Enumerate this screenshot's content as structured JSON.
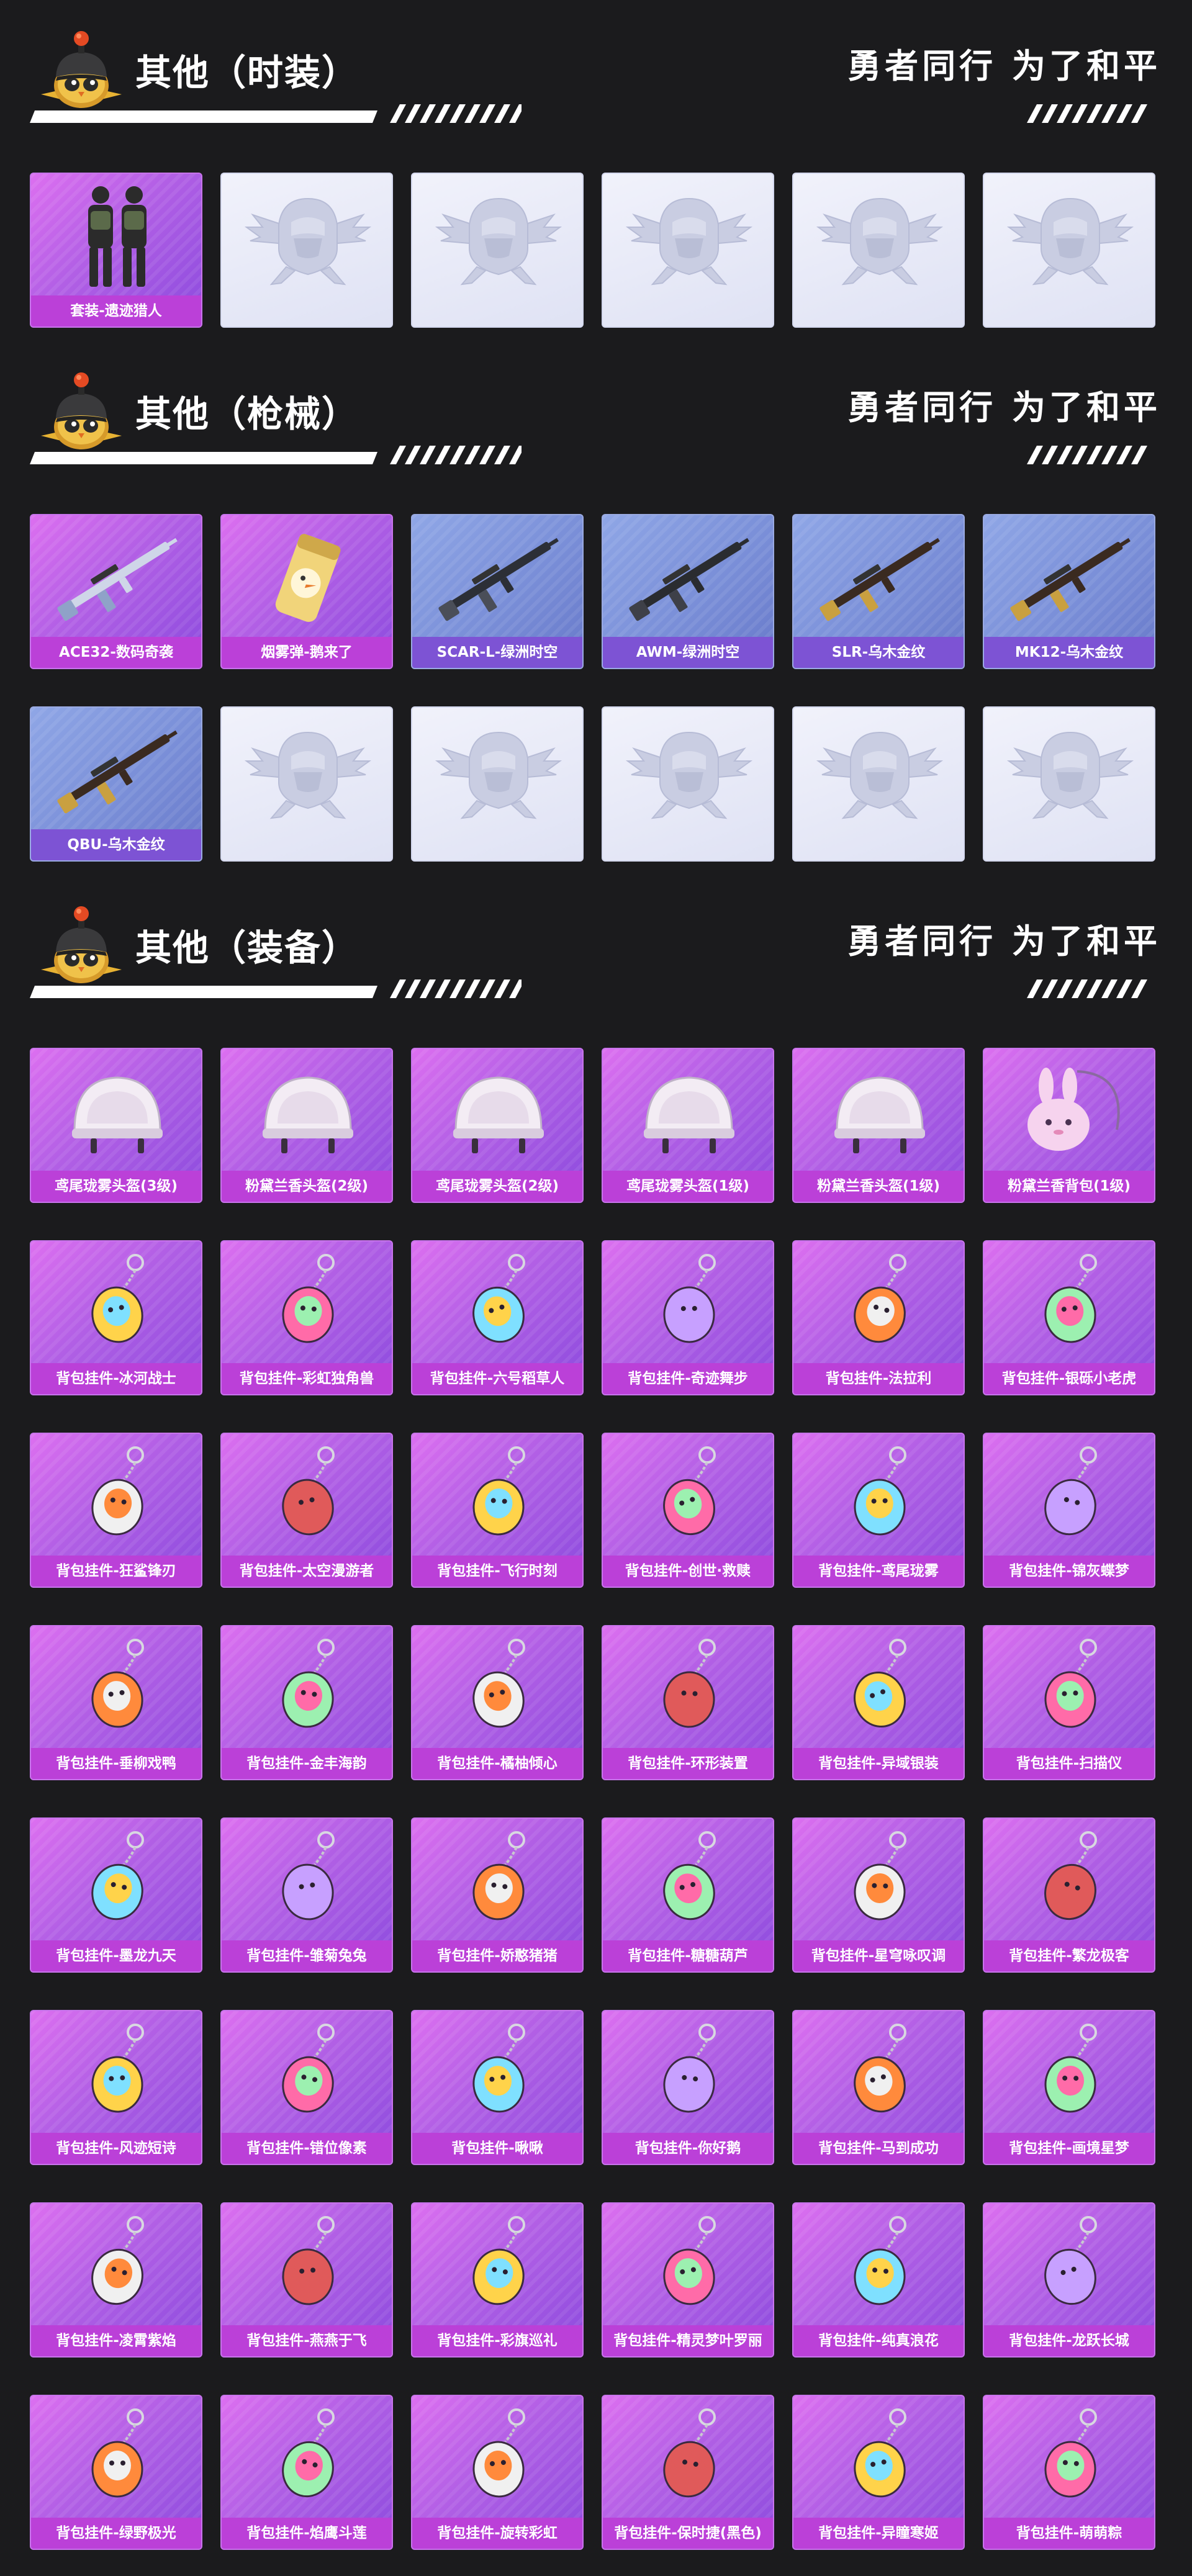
{
  "slogan": "勇者同行 为了和平",
  "sections": [
    {
      "title": "其他（时装）",
      "rows": [
        [
          {
            "label": "套装-遗迹猎人",
            "style": "purple",
            "icon": "outfit-icon"
          },
          {
            "style": "empty",
            "icon": "placeholder-emblem-icon"
          },
          {
            "style": "empty",
            "icon": "placeholder-emblem-icon"
          },
          {
            "style": "empty",
            "icon": "placeholder-emblem-icon"
          },
          {
            "style": "empty",
            "icon": "placeholder-emblem-icon"
          },
          {
            "style": "empty",
            "icon": "placeholder-emblem-icon"
          }
        ]
      ]
    },
    {
      "title": "其他（枪械）",
      "rows": [
        [
          {
            "label": "ACE32-数码奇袭",
            "style": "purple",
            "icon": "rifle-icon"
          },
          {
            "label": "烟雾弹-鹅来了",
            "style": "purple",
            "icon": "smoke-grenade-icon"
          },
          {
            "label": "SCAR-L-绿洲时空",
            "style": "blue",
            "icon": "rifle-icon"
          },
          {
            "label": "AWM-绿洲时空",
            "style": "blue",
            "icon": "sniper-rifle-icon"
          },
          {
            "label": "SLR-乌木金纹",
            "style": "blue",
            "icon": "marksman-rifle-icon"
          },
          {
            "label": "MK12-乌木金纹",
            "style": "blue",
            "icon": "marksman-rifle-icon"
          }
        ],
        [
          {
            "label": "QBU-乌木金纹",
            "style": "blue",
            "icon": "marksman-rifle-icon"
          },
          {
            "style": "empty",
            "icon": "placeholder-emblem-icon"
          },
          {
            "style": "empty",
            "icon": "placeholder-emblem-icon"
          },
          {
            "style": "empty",
            "icon": "placeholder-emblem-icon"
          },
          {
            "style": "empty",
            "icon": "placeholder-emblem-icon"
          },
          {
            "style": "empty",
            "icon": "placeholder-emblem-icon"
          }
        ]
      ]
    },
    {
      "title": "其他（装备）",
      "rows": [
        [
          {
            "label": "鸢尾珑雾头盔(3级)",
            "style": "purple",
            "icon": "helmet-icon"
          },
          {
            "label": "粉黛兰香头盔(2级)",
            "style": "purple",
            "icon": "helmet-icon"
          },
          {
            "label": "鸢尾珑雾头盔(2级)",
            "style": "purple",
            "icon": "helmet-icon"
          },
          {
            "label": "鸢尾珑雾头盔(1级)",
            "style": "purple",
            "icon": "helmet-icon"
          },
          {
            "label": "粉黛兰香头盔(1级)",
            "style": "purple",
            "icon": "helmet-icon"
          },
          {
            "label": "粉黛兰香背包(1级)",
            "style": "purple",
            "icon": "backpack-icon"
          }
        ],
        [
          {
            "label": "背包挂件-冰河战士",
            "style": "purple",
            "icon": "keychain-icon"
          },
          {
            "label": "背包挂件-彩虹独角兽",
            "style": "purple",
            "icon": "keychain-icon"
          },
          {
            "label": "背包挂件-六号稻草人",
            "style": "purple",
            "icon": "keychain-icon"
          },
          {
            "label": "背包挂件-奇迹舞步",
            "style": "purple",
            "icon": "keychain-icon"
          },
          {
            "label": "背包挂件-法拉利",
            "style": "purple",
            "icon": "keychain-icon"
          },
          {
            "label": "背包挂件-银砾小老虎",
            "style": "purple",
            "icon": "keychain-icon"
          }
        ],
        [
          {
            "label": "背包挂件-狂鲨锋刃",
            "style": "purple",
            "icon": "keychain-icon"
          },
          {
            "label": "背包挂件-太空漫游者",
            "style": "purple",
            "icon": "keychain-icon"
          },
          {
            "label": "背包挂件-飞行时刻",
            "style": "purple",
            "icon": "keychain-icon"
          },
          {
            "label": "背包挂件-创世·救赎",
            "style": "purple",
            "icon": "keychain-icon"
          },
          {
            "label": "背包挂件-鸢尾珑雾",
            "style": "purple",
            "icon": "keychain-icon"
          },
          {
            "label": "背包挂件-锦灰蝶梦",
            "style": "purple",
            "icon": "keychain-icon"
          }
        ],
        [
          {
            "label": "背包挂件-垂柳戏鸭",
            "style": "purple",
            "icon": "keychain-icon"
          },
          {
            "label": "背包挂件-金丰海韵",
            "style": "purple",
            "icon": "keychain-icon"
          },
          {
            "label": "背包挂件-橘柚倾心",
            "style": "purple",
            "icon": "keychain-icon"
          },
          {
            "label": "背包挂件-环形装置",
            "style": "purple",
            "icon": "keychain-icon"
          },
          {
            "label": "背包挂件-异域银装",
            "style": "purple",
            "icon": "keychain-icon"
          },
          {
            "label": "背包挂件-扫描仪",
            "style": "purple",
            "icon": "keychain-icon"
          }
        ],
        [
          {
            "label": "背包挂件-墨龙九天",
            "style": "purple",
            "icon": "keychain-icon"
          },
          {
            "label": "背包挂件-雏菊兔兔",
            "style": "purple",
            "icon": "keychain-icon"
          },
          {
            "label": "背包挂件-娇憨猪猪",
            "style": "purple",
            "icon": "keychain-icon"
          },
          {
            "label": "背包挂件-糖糖葫芦",
            "style": "purple",
            "icon": "keychain-icon"
          },
          {
            "label": "背包挂件-星穹咏叹调",
            "style": "purple",
            "icon": "keychain-icon"
          },
          {
            "label": "背包挂件-繁龙极客",
            "style": "purple",
            "icon": "keychain-icon"
          }
        ],
        [
          {
            "label": "背包挂件-风迹短诗",
            "style": "purple",
            "icon": "keychain-icon"
          },
          {
            "label": "背包挂件-错位像素",
            "style": "purple",
            "icon": "keychain-icon"
          },
          {
            "label": "背包挂件-啾啾",
            "style": "purple",
            "icon": "keychain-icon"
          },
          {
            "label": "背包挂件-你好鹅",
            "style": "purple",
            "icon": "keychain-icon"
          },
          {
            "label": "背包挂件-马到成功",
            "style": "purple",
            "icon": "keychain-icon"
          },
          {
            "label": "背包挂件-画境星梦",
            "style": "purple",
            "icon": "keychain-icon"
          }
        ],
        [
          {
            "label": "背包挂件-凌霄紫焰",
            "style": "purple",
            "icon": "keychain-icon"
          },
          {
            "label": "背包挂件-燕燕于飞",
            "style": "purple",
            "icon": "keychain-icon"
          },
          {
            "label": "背包挂件-彩旗巡礼",
            "style": "purple",
            "icon": "keychain-icon"
          },
          {
            "label": "背包挂件-精灵梦叶罗丽",
            "style": "purple",
            "icon": "keychain-icon"
          },
          {
            "label": "背包挂件-纯真浪花",
            "style": "purple",
            "icon": "keychain-icon"
          },
          {
            "label": "背包挂件-龙跃长城",
            "style": "purple",
            "icon": "keychain-icon"
          }
        ],
        [
          {
            "label": "背包挂件-绿野极光",
            "style": "purple",
            "icon": "keychain-icon"
          },
          {
            "label": "背包挂件-焰鹰斗莲",
            "style": "purple",
            "icon": "keychain-icon"
          },
          {
            "label": "背包挂件-旋转彩虹",
            "style": "purple",
            "icon": "keychain-icon"
          },
          {
            "label": "背包挂件-保时捷(黑色)",
            "style": "purple",
            "icon": "keychain-icon"
          },
          {
            "label": "背包挂件-异瞳寒姬",
            "style": "purple",
            "icon": "keychain-icon"
          },
          {
            "label": "背包挂件-萌萌粽",
            "style": "purple",
            "icon": "keychain-icon"
          }
        ]
      ]
    }
  ]
}
